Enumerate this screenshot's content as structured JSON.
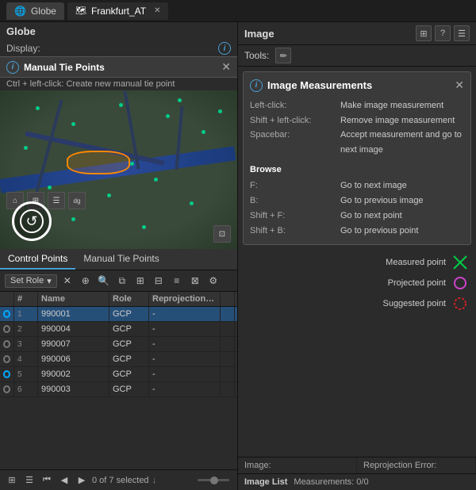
{
  "titleBar": {
    "tabs": [
      {
        "id": "globe",
        "label": "Globe",
        "icon": "🌐",
        "active": false
      },
      {
        "id": "frankfurt",
        "label": "Frankfurt_AT",
        "active": true,
        "closable": true
      }
    ]
  },
  "leftPanel": {
    "title": "Globe",
    "displayLabel": "Display:",
    "mtp": {
      "title": "Manual Tie Points",
      "hint": "Ctrl + left-click:  Create new manual tie point"
    },
    "controlPoints": {
      "tabs": [
        "Control Points",
        "Manual Tie Points"
      ],
      "activeTab": 0,
      "toolbar": {
        "roleLabel": "Set Role",
        "buttons": [
          "✕",
          "⊕",
          "⊖",
          "⊗",
          "◈",
          "⧉",
          "⬚",
          "◩",
          "⬛",
          "⚙"
        ]
      },
      "table": {
        "headers": [
          "",
          "#",
          "Name",
          "Role",
          "Reprojection RMSE",
          ""
        ],
        "rows": [
          {
            "num": "1",
            "status": "active",
            "name": "990001",
            "role": "GCP",
            "rmse": "-",
            "selected": true
          },
          {
            "num": "2",
            "status": "",
            "name": "990004",
            "role": "GCP",
            "rmse": "-"
          },
          {
            "num": "3",
            "status": "",
            "name": "990007",
            "role": "GCP",
            "rmse": "-"
          },
          {
            "num": "4",
            "status": "",
            "name": "990006",
            "role": "GCP",
            "rmse": "-"
          },
          {
            "num": "5",
            "status": "active",
            "name": "990002",
            "role": "GCP",
            "rmse": "-"
          },
          {
            "num": "6",
            "status": "",
            "name": "990003",
            "role": "GCP",
            "rmse": "-"
          }
        ]
      }
    },
    "bottomBar": {
      "selectedText": "0 of 7 selected"
    }
  },
  "rightPanel": {
    "title": "Image",
    "toolsLabel": "Tools:",
    "measurements": {
      "title": "Image Measurements",
      "rows": [
        {
          "key": "Left-click:",
          "val": "Make image measurement"
        },
        {
          "key": "Shift + left-click:",
          "val": "Remove image measurement"
        },
        {
          "key": "Spacebar:",
          "val": "Accept measurement and go to next image"
        }
      ],
      "browseSection": "Browse",
      "browseRows": [
        {
          "key": "F:",
          "val": "Go to next image"
        },
        {
          "key": "B:",
          "val": "Go to previous image"
        },
        {
          "key": "Shift + F:",
          "val": "Go to next point"
        },
        {
          "key": "Shift + B:",
          "val": "Go to previous point"
        }
      ]
    },
    "legend": [
      {
        "label": "Measured point",
        "color": "#00cc44",
        "shape": "x"
      },
      {
        "label": "Projected point",
        "color": "#cc44cc",
        "shape": "circle"
      },
      {
        "label": "Suggested point",
        "color": "#cc2222",
        "shape": "dashed-circle"
      }
    ],
    "imageStatus": {
      "imageLabel": "Image:",
      "reprojLabel": "Reprojection Error:"
    },
    "imageList": {
      "label": "Image List",
      "measurements": "Measurements: 0/0"
    }
  }
}
